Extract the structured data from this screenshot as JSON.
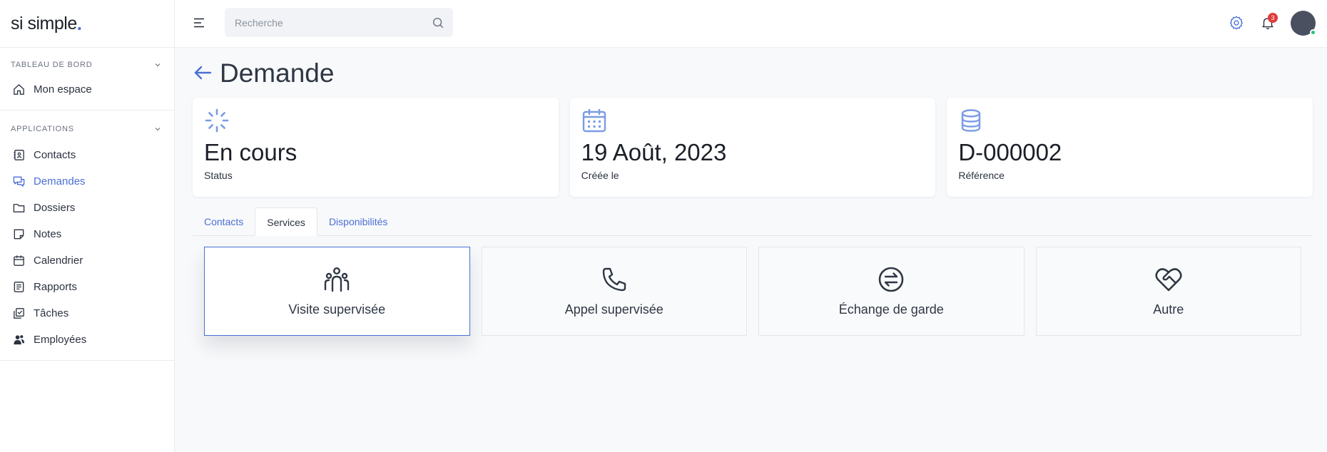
{
  "brand": {
    "name": "si simple",
    "dot": "."
  },
  "sidebar": {
    "sections": [
      {
        "title": "TABLEAU DE BORD",
        "items": [
          {
            "label": "Mon espace",
            "icon": "home-icon"
          }
        ]
      },
      {
        "title": "APPLICATIONS",
        "items": [
          {
            "label": "Contacts",
            "icon": "contacts-book-icon"
          },
          {
            "label": "Demandes",
            "icon": "chat-icon",
            "active": true
          },
          {
            "label": "Dossiers",
            "icon": "folder-icon"
          },
          {
            "label": "Notes",
            "icon": "note-icon"
          },
          {
            "label": "Calendrier",
            "icon": "calendar-icon"
          },
          {
            "label": "Rapports",
            "icon": "report-icon"
          },
          {
            "label": "Tâches",
            "icon": "tasks-icon"
          },
          {
            "label": "Employées",
            "icon": "employees-icon"
          }
        ]
      }
    ]
  },
  "topbar": {
    "search": {
      "placeholder": "Recherche",
      "value": ""
    },
    "notifications": {
      "count": "3"
    }
  },
  "page": {
    "title": "Demande"
  },
  "cards": [
    {
      "value": "En cours",
      "label": "Status",
      "icon": "loader-icon"
    },
    {
      "value": "19 Août, 2023",
      "label": "Créée le",
      "icon": "calendar-icon"
    },
    {
      "value": "D-000002",
      "label": "Référence",
      "icon": "database-icon"
    }
  ],
  "tabs": [
    {
      "label": "Contacts"
    },
    {
      "label": "Services",
      "active": true
    },
    {
      "label": "Disponibilités"
    }
  ],
  "services": [
    {
      "label": "Visite supervisée",
      "icon": "group-icon",
      "selected": true
    },
    {
      "label": "Appel supervisée",
      "icon": "phone-icon"
    },
    {
      "label": "Échange de garde",
      "icon": "exchange-icon"
    },
    {
      "label": "Autre",
      "icon": "heart-handshake-icon"
    }
  ],
  "colors": {
    "accent": "#4b6fd6",
    "card_icon": "#7a9be6",
    "badge": "#e03a3a",
    "online": "#2ec27e"
  }
}
